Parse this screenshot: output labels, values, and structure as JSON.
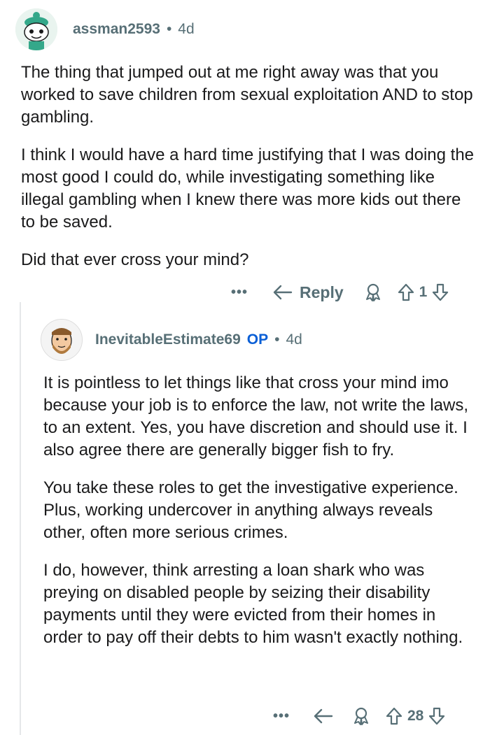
{
  "parent": {
    "username": "assman2593",
    "age": "4d",
    "paragraphs": [
      "The thing that jumped out at me right away was that you worked to save children from sexual exploitation AND to stop gambling.",
      "I think I would have a hard time justifying that I was doing the most good I could do, while investigating something like illegal gambling when I knew there was more kids out there to be saved.",
      "Did that ever cross your mind?"
    ],
    "more": "•••",
    "reply_label": "Reply",
    "votes": "1"
  },
  "reply": {
    "username": "InevitableEstimate69",
    "op_badge": "OP",
    "age": "4d",
    "paragraphs": [
      "It is pointless to let things like that cross your mind imo because your job is to enforce the law, not write the laws, to an extent. Yes, you have discretion and should use it. I also agree there are generally bigger fish to fry.",
      "You take these roles to get the investigative experience. Plus, working undercover in anything always reveals other, often more serious crimes.",
      "I do, however, think arresting a loan shark who was preying on disabled people by seizing their disability payments until they were evicted from their homes in order to pay off their debts to him wasn't exactly nothing."
    ],
    "more": "•••",
    "votes": "28"
  },
  "colors": {
    "meta": "#576f76",
    "op": "#0a5fd6",
    "text": "#1a1a1b",
    "line": "#e5e7e9"
  },
  "icons": [
    "avatar-snoo-icon",
    "avatar-bearded-icon",
    "more-icon",
    "reply-arrow-icon",
    "award-icon",
    "upvote-icon",
    "downvote-icon"
  ]
}
